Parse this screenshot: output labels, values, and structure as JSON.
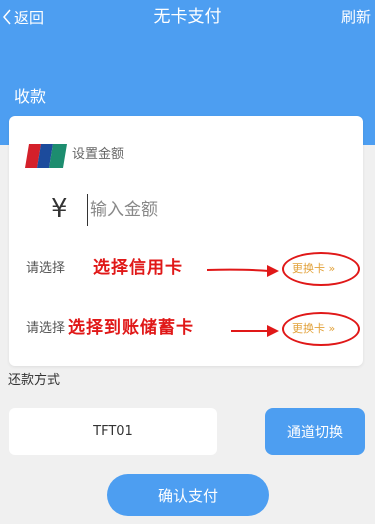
{
  "nav": {
    "back_label": "返回",
    "title": "无卡支付",
    "refresh_label": "刷新"
  },
  "section": {
    "receive_label": "收款"
  },
  "card": {
    "header_label": "设置金额",
    "currency_symbol": "¥",
    "amount_placeholder": "输入金额",
    "rows": [
      {
        "label": "请选择",
        "annotation": "选择信用卡",
        "change_button": "更换卡 »"
      },
      {
        "label": "请选择",
        "annotation": "选择到账储蓄卡",
        "change_button": "更换卡 »"
      }
    ]
  },
  "repayment": {
    "label": "还款方式",
    "channel_value": "TFT01",
    "switch_button": "通道切换"
  },
  "confirm_button": "确认支付",
  "colors": {
    "header_blue": "#4d9ef1",
    "annotation_red": "#e01818",
    "change_card_orange": "#e2a23b"
  }
}
